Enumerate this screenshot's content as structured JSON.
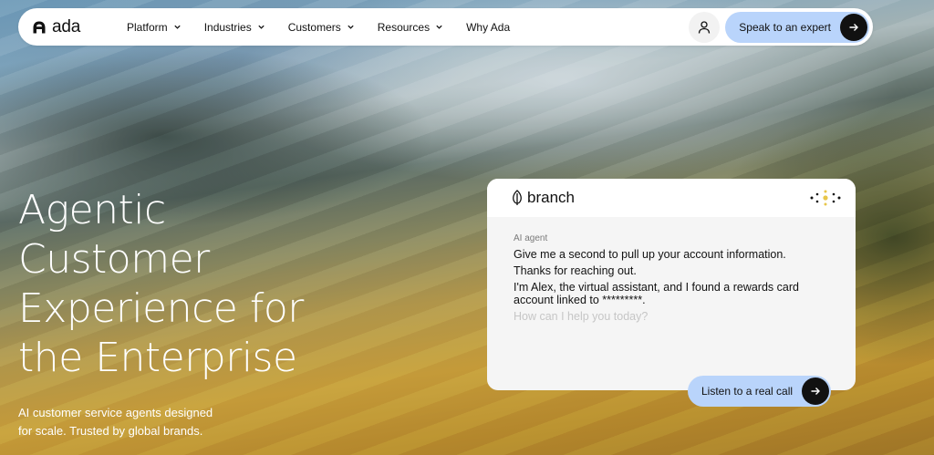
{
  "nav": {
    "logo_text": "ada",
    "menu": [
      {
        "label": "Platform",
        "dropdown": true
      },
      {
        "label": "Industries",
        "dropdown": true
      },
      {
        "label": "Customers",
        "dropdown": true
      },
      {
        "label": "Resources",
        "dropdown": true
      },
      {
        "label": "Why Ada",
        "dropdown": false
      }
    ],
    "cta_label": "Speak to an expert"
  },
  "hero": {
    "title_lines": [
      "Agentic",
      "Customer",
      "Experience for",
      "the Enterprise"
    ],
    "subtitle_lines": [
      "AI customer service agents designed",
      "for scale. Trusted by global brands."
    ]
  },
  "chat_card": {
    "brand_name": "branch",
    "agent_label": "AI agent",
    "messages": [
      "Give me a second to pull up your account information.",
      "Thanks for reaching out.",
      "I'm Alex, the virtual assistant, and I found a rewards card account linked to *********."
    ],
    "input_placeholder": "How can I help you today?",
    "listen_button_label": "Listen to a real call"
  },
  "colors": {
    "cta_background": "#b9d4fb",
    "arrow_circle": "#111111",
    "nav_background": "#ffffff"
  }
}
